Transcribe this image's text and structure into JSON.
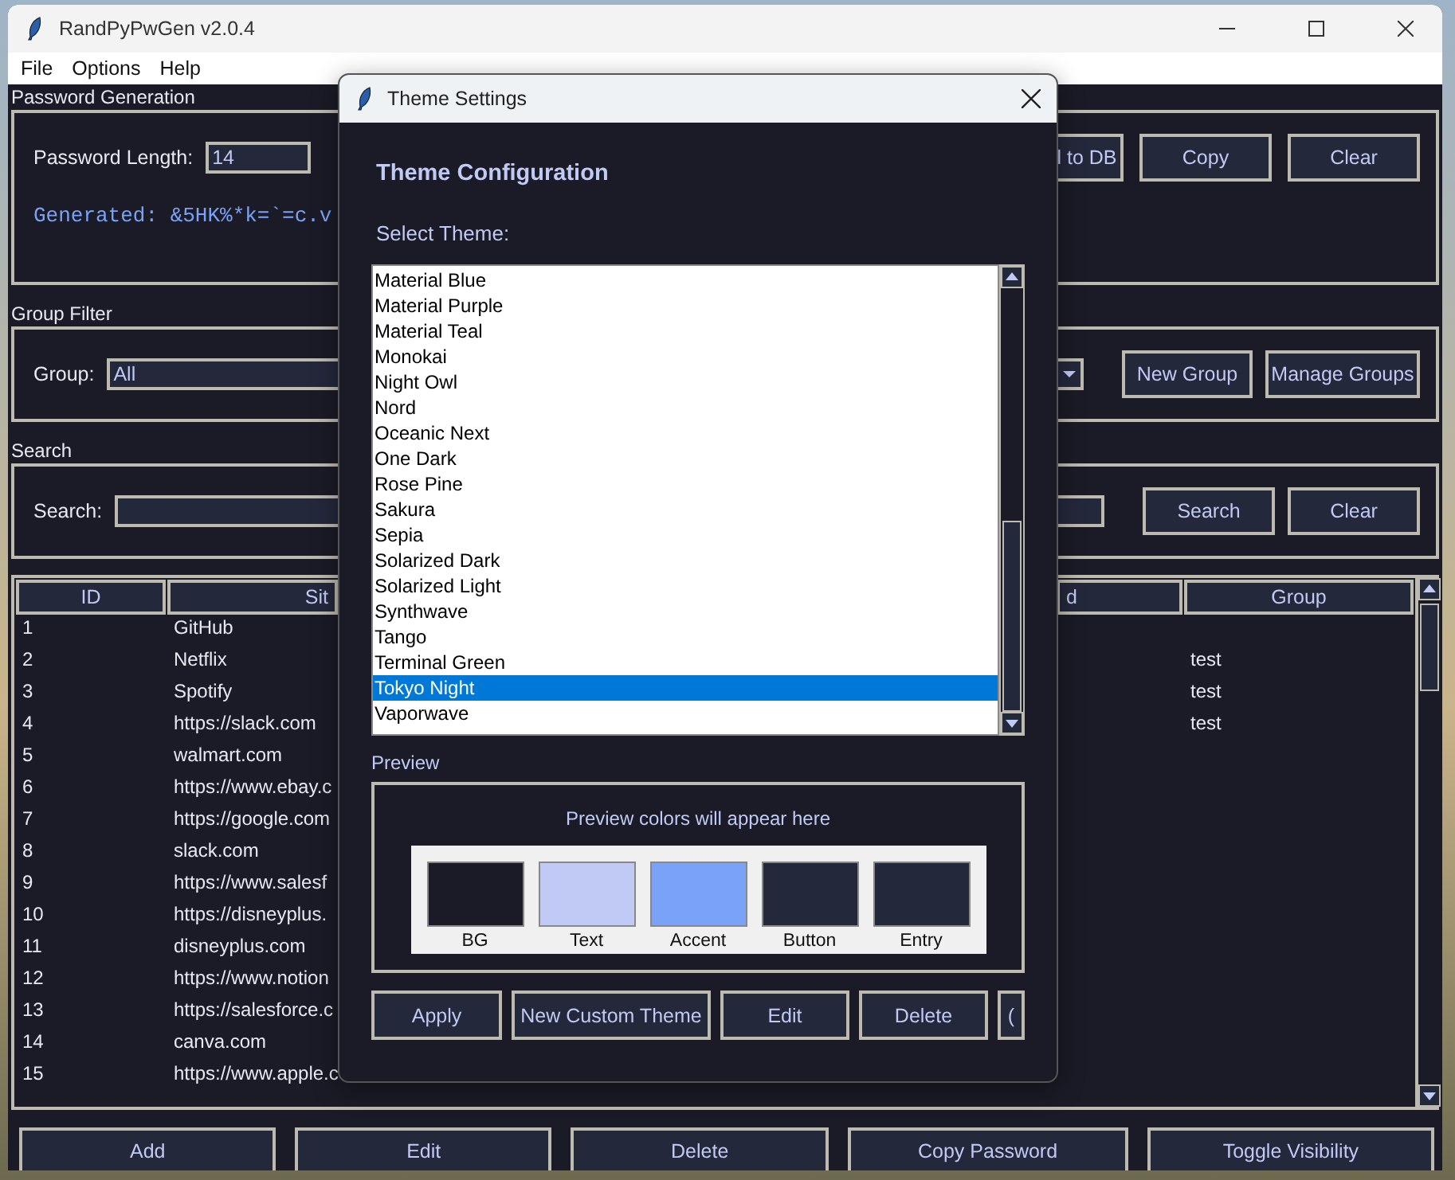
{
  "window": {
    "title": "RandPyPwGen v2.0.4"
  },
  "menu": [
    "File",
    "Options",
    "Help"
  ],
  "password_generation": {
    "title": "Password Generation",
    "length_label": "Password Length:",
    "length_value": "14",
    "generated": "Generated: &5HK%*k=`=c.v",
    "buttons": [
      "l to DB",
      "Copy",
      "Clear"
    ]
  },
  "group_filter": {
    "title": "Group Filter",
    "label": "Group:",
    "value": "All",
    "buttons": [
      "New Group",
      "Manage Groups"
    ]
  },
  "search": {
    "title": "Search",
    "label": "Search:",
    "buttons": [
      "Search",
      "Clear"
    ]
  },
  "table": {
    "columns": [
      "ID",
      "Sit",
      "d",
      "Group"
    ],
    "rows": [
      {
        "id": "1",
        "site": "GitHub"
      },
      {
        "id": "2",
        "site": "Netflix",
        "group": "test"
      },
      {
        "id": "3",
        "site": "Spotify",
        "group": "test"
      },
      {
        "id": "4",
        "site": "https://slack.com",
        "group": "test"
      },
      {
        "id": "5",
        "site": "walmart.com"
      },
      {
        "id": "6",
        "site": "https://www.ebay.c"
      },
      {
        "id": "7",
        "site": "https://google.com"
      },
      {
        "id": "8",
        "site": "slack.com"
      },
      {
        "id": "9",
        "site": "https://www.salesf"
      },
      {
        "id": "10",
        "site": "https://disneyplus."
      },
      {
        "id": "11",
        "site": "disneyplus.com"
      },
      {
        "id": "12",
        "site": "https://www.notion"
      },
      {
        "id": "13",
        "site": "https://salesforce.c"
      },
      {
        "id": "14",
        "site": "canva.com"
      },
      {
        "id": "15",
        "site": "https://www.apple.c"
      }
    ]
  },
  "bottom_buttons": [
    "Add",
    "Edit",
    "Delete",
    "Copy Password",
    "Toggle Visibility"
  ],
  "dialog": {
    "title": "Theme Settings",
    "heading": "Theme Configuration",
    "select_label": "Select Theme:",
    "themes": [
      {
        "name": "Material Blue",
        "selected": false
      },
      {
        "name": "Material Purple",
        "selected": false
      },
      {
        "name": "Material Teal",
        "selected": false
      },
      {
        "name": "Monokai",
        "selected": false
      },
      {
        "name": "Night Owl",
        "selected": false
      },
      {
        "name": "Nord",
        "selected": false
      },
      {
        "name": "Oceanic Next",
        "selected": false
      },
      {
        "name": "One Dark",
        "selected": false
      },
      {
        "name": "Rose Pine",
        "selected": false
      },
      {
        "name": "Sakura",
        "selected": false
      },
      {
        "name": "Sepia",
        "selected": false
      },
      {
        "name": "Solarized Dark",
        "selected": false
      },
      {
        "name": "Solarized Light",
        "selected": false
      },
      {
        "name": "Synthwave",
        "selected": false
      },
      {
        "name": "Tango",
        "selected": false
      },
      {
        "name": "Terminal Green",
        "selected": false
      },
      {
        "name": "Tokyo Night",
        "selected": true
      },
      {
        "name": "Vaporwave",
        "selected": false
      }
    ],
    "preview_title": "Preview",
    "preview_note": "Preview colors will appear here",
    "swatches": [
      {
        "label": "BG",
        "color": "#1a1b26"
      },
      {
        "label": "Text",
        "color": "#c0caf5"
      },
      {
        "label": "Accent",
        "color": "#7aa2f7"
      },
      {
        "label": "Button",
        "color": "#24283b"
      },
      {
        "label": "Entry",
        "color": "#24283b"
      }
    ],
    "buttons": [
      "Apply",
      "New Custom Theme",
      "Edit",
      "Delete",
      "("
    ]
  }
}
